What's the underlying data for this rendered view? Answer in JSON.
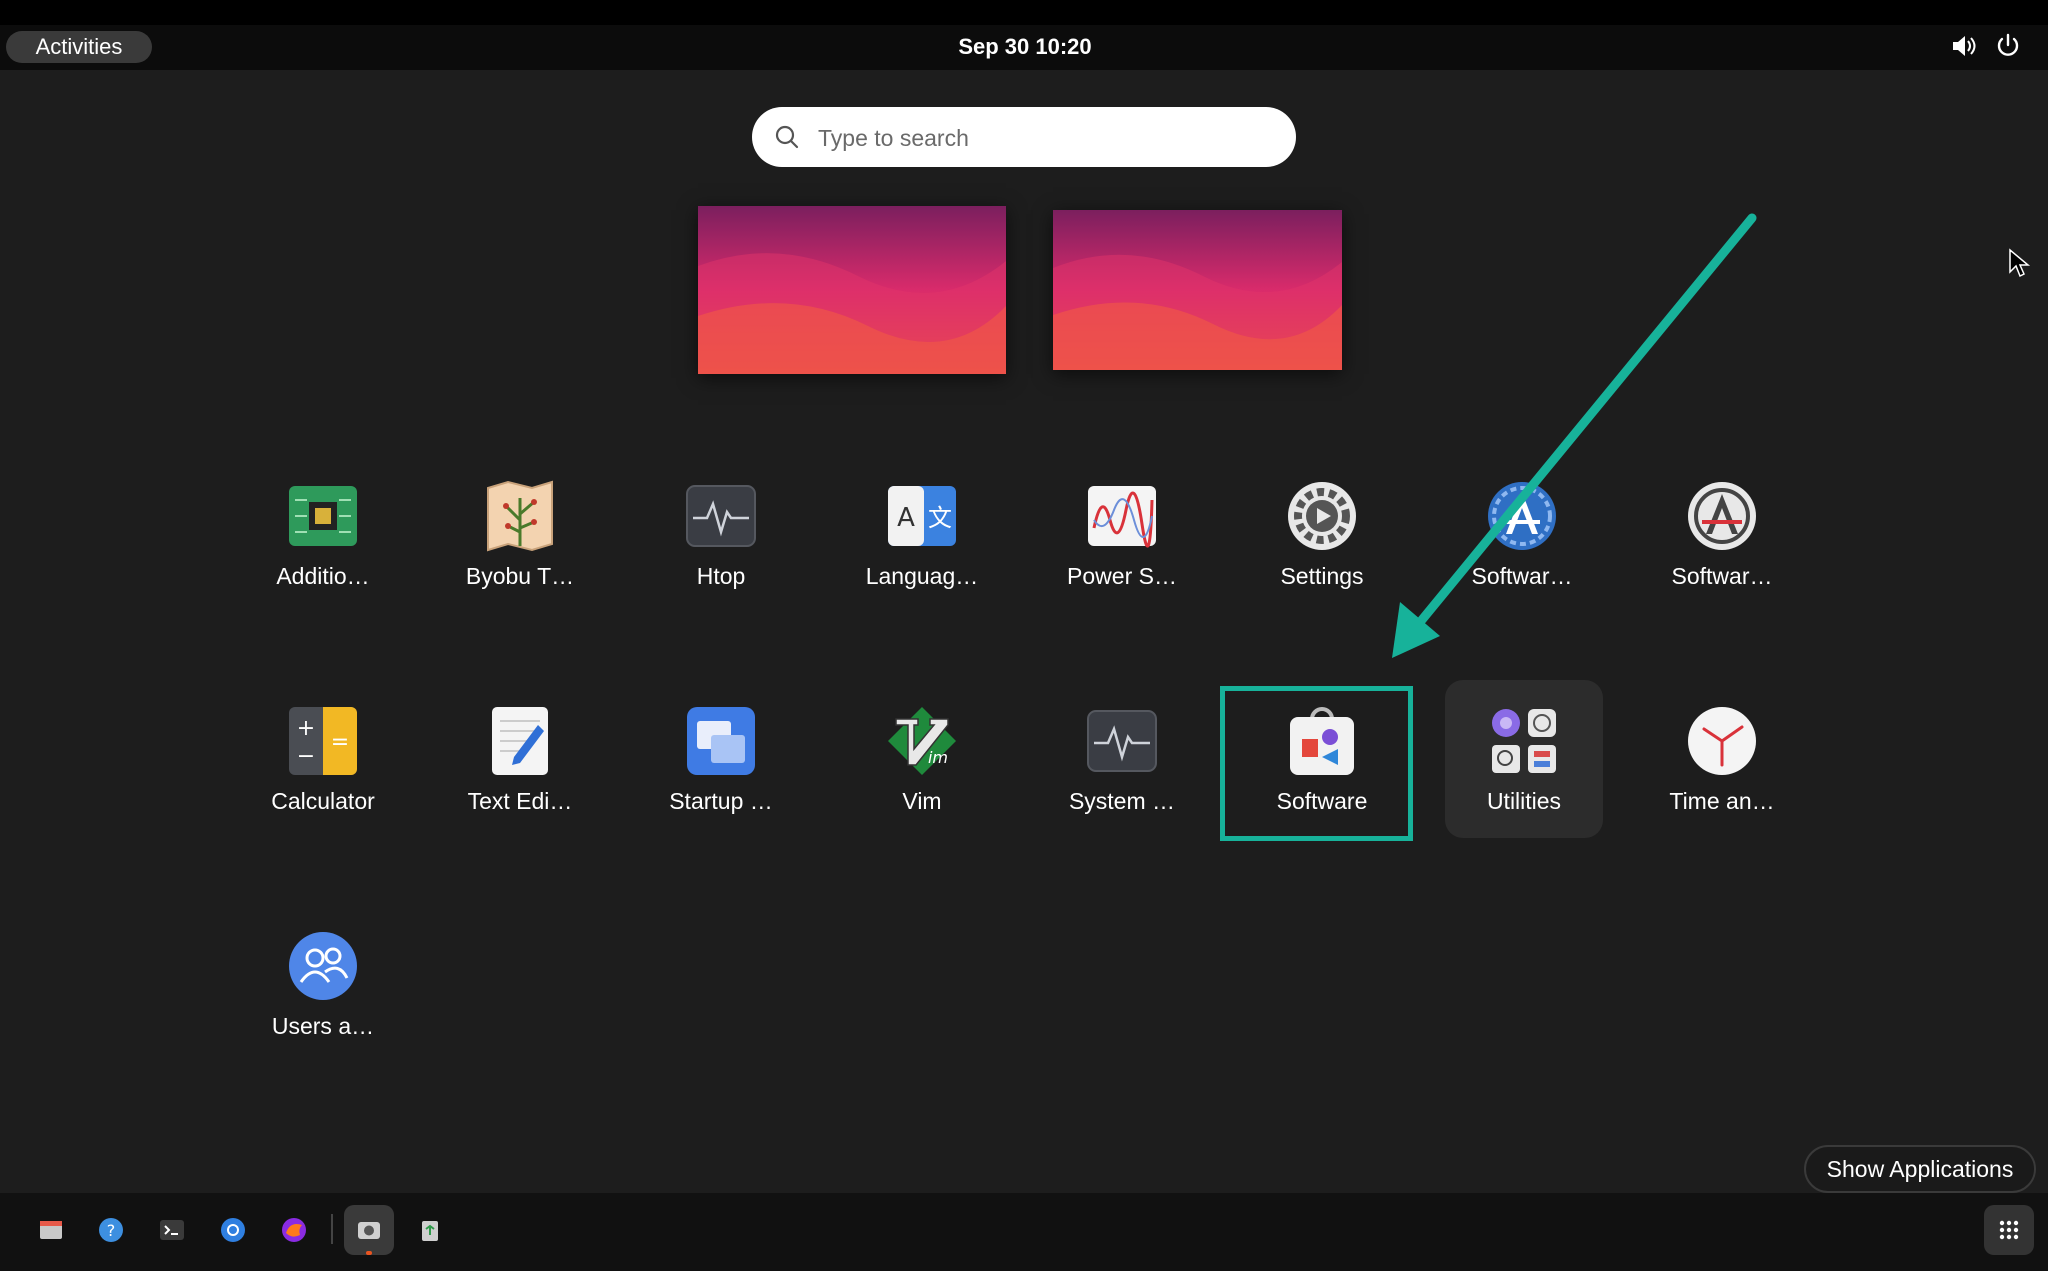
{
  "topbar": {
    "activities_label": "Activities",
    "clock": "Sep 30  10:20",
    "tray_icons": [
      "volume-icon",
      "power-icon"
    ]
  },
  "search": {
    "placeholder": "Type to search"
  },
  "workspaces": [
    "workspace-1",
    "workspace-2"
  ],
  "apps": {
    "row1": [
      {
        "label": "Additio…",
        "icon": "chip-icon"
      },
      {
        "label": "Byobu T…",
        "icon": "map-icon"
      },
      {
        "label": "Htop",
        "icon": "activity-monitor-icon"
      },
      {
        "label": "Languag…",
        "icon": "language-icon"
      },
      {
        "label": "Power S…",
        "icon": "power-stats-icon"
      },
      {
        "label": "Settings",
        "icon": "gear-icon"
      },
      {
        "label": "Softwar…",
        "icon": "software-updater-icon"
      },
      {
        "label": "Softwar…",
        "icon": "software-properties-icon"
      }
    ],
    "row2": [
      {
        "label": "Calculator",
        "icon": "calculator-icon"
      },
      {
        "label": "Text Edi…",
        "icon": "text-editor-icon"
      },
      {
        "label": "Startup …",
        "icon": "startup-disk-icon"
      },
      {
        "label": "Vim",
        "icon": "vim-icon"
      },
      {
        "label": "System …",
        "icon": "system-monitor-icon"
      },
      {
        "label": "Software",
        "icon": "software-store-icon"
      },
      {
        "label": "Utilities",
        "icon": "utilities-folder-icon"
      },
      {
        "label": "Time an…",
        "icon": "clock-icon"
      }
    ],
    "row3": [
      {
        "label": "Users a…",
        "icon": "users-icon"
      }
    ]
  },
  "annotation": {
    "color": "#17b29a",
    "target": "Software"
  },
  "show_applications_label": "Show Applications",
  "dock": [
    "files-icon",
    "help-icon",
    "terminal-icon",
    "chromium-icon",
    "firefox-icon",
    "screenshot-icon",
    "trash-icon",
    "app-grid-icon"
  ],
  "colors": {
    "accent": "#17b29a",
    "background": "#1d1d1d",
    "topbar": "#000000"
  }
}
